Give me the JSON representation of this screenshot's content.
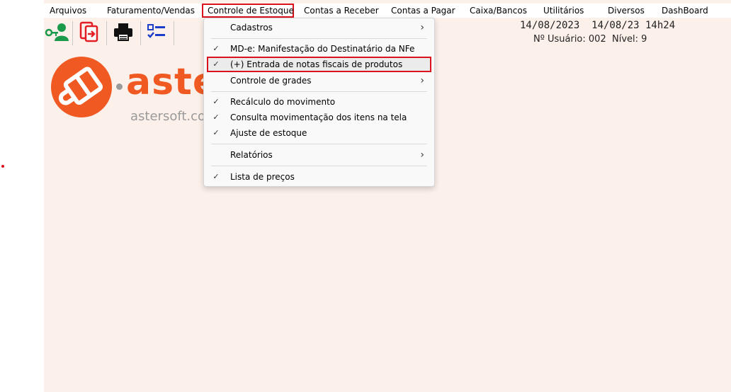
{
  "menubar": {
    "items": [
      {
        "label": "Arquivos"
      },
      {
        "label": "Faturamento/Vendas"
      },
      {
        "label": "Controle de Estoque"
      },
      {
        "label": "Contas a Receber"
      },
      {
        "label": "Contas a Pagar"
      },
      {
        "label": "Caixa/Bancos"
      },
      {
        "label": "Utilitários"
      },
      {
        "label": "Diversos"
      },
      {
        "label": "DashBoard"
      }
    ]
  },
  "toolbar": {
    "icons": [
      "user-key-icon",
      "exit-door-icon",
      "printer-icon",
      "checklist-icon"
    ]
  },
  "status": {
    "dates": "14/08/2023  14/08/23 14h24",
    "user": "Nº Usuário: 002  Nível: 9"
  },
  "logo": {
    "word": "aste",
    "url": "astersoft.co"
  },
  "dropdown": {
    "items": [
      {
        "label": "Cadastros",
        "check": "",
        "arrow": "›"
      },
      {
        "label": "MD-e: Manifestação do Destinatário da NFe",
        "check": "✓",
        "arrow": ""
      },
      {
        "label": "(+) Entrada de notas fiscais de produtos",
        "check": "✓",
        "arrow": ""
      },
      {
        "label": "Controle de grades",
        "check": "",
        "arrow": "›"
      },
      {
        "label": "Recálculo do movimento",
        "check": "✓",
        "arrow": ""
      },
      {
        "label": "Consulta movimentação dos itens na tela",
        "check": "✓",
        "arrow": ""
      },
      {
        "label": "Ajuste de estoque",
        "check": "✓",
        "arrow": ""
      },
      {
        "label": "Relatórios",
        "check": "",
        "arrow": "›"
      },
      {
        "label": "Lista de preços",
        "check": "✓",
        "arrow": ""
      }
    ]
  },
  "colors": {
    "accent": "#d9121b",
    "brand": "#f05a22",
    "background": "#fcf0ea"
  }
}
